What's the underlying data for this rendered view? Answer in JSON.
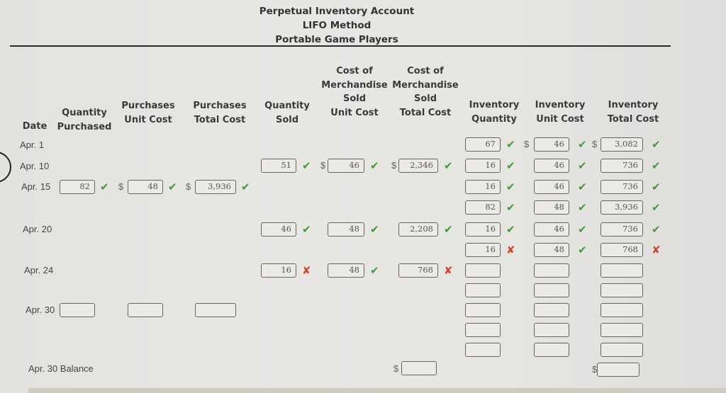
{
  "title": {
    "line1": "Perpetual Inventory Account",
    "line2": "LIFO Method",
    "line3": "Portable Game Players"
  },
  "headers": {
    "date": "Date",
    "qty_purchased": [
      "Quantity",
      "Purchased"
    ],
    "purch_unit_cost": [
      "Purchases",
      "Unit Cost"
    ],
    "purch_total_cost": [
      "Purchases",
      "Total Cost"
    ],
    "qty_sold": [
      "Quantity",
      "Sold"
    ],
    "cogs_unit_cost": [
      "Cost of",
      "Merchandise",
      "Sold",
      "Unit Cost"
    ],
    "cogs_total_cost": [
      "Cost of",
      "Merchandise",
      "Sold",
      "Total Cost"
    ],
    "inv_qty": [
      "Inventory",
      "Quantity"
    ],
    "inv_unit_cost": [
      "Inventory",
      "Unit Cost"
    ],
    "inv_total_cost": [
      "Inventory",
      "Total Cost"
    ]
  },
  "currency_symbol": "$",
  "marks": {
    "correct": "✔",
    "incorrect": "✘"
  },
  "rows": [
    {
      "date": "Apr. 1",
      "inventory": [
        {
          "qty": "67",
          "qty_status": "correct",
          "unit_cost": "46",
          "unit_status": "correct",
          "total": "3,082",
          "total_status": "correct"
        }
      ]
    },
    {
      "date": "Apr. 10",
      "sold": {
        "qty": "51",
        "qty_status": "correct",
        "unit_cost": "46",
        "unit_status": "correct",
        "total": "2,346",
        "total_status": "correct"
      },
      "inventory": [
        {
          "qty": "16",
          "qty_status": "correct",
          "unit_cost": "46",
          "unit_status": "correct",
          "total": "736",
          "total_status": "correct"
        }
      ]
    },
    {
      "date": "Apr. 15",
      "purchase": {
        "qty": "82",
        "qty_status": "correct",
        "unit_cost": "48",
        "unit_status": "correct",
        "total": "3,936",
        "total_status": "correct"
      },
      "inventory": [
        {
          "qty": "16",
          "qty_status": "correct",
          "unit_cost": "46",
          "unit_status": "correct",
          "total": "736",
          "total_status": "correct"
        },
        {
          "qty": "82",
          "qty_status": "correct",
          "unit_cost": "48",
          "unit_status": "correct",
          "total": "3,936",
          "total_status": "correct"
        }
      ]
    },
    {
      "date": "Apr. 20",
      "sold": {
        "qty": "46",
        "qty_status": "correct",
        "unit_cost": "48",
        "unit_status": "correct",
        "total": "2,208",
        "total_status": "correct"
      },
      "inventory": [
        {
          "qty": "16",
          "qty_status": "correct",
          "unit_cost": "46",
          "unit_status": "correct",
          "total": "736",
          "total_status": "correct"
        },
        {
          "qty": "16",
          "qty_status": "incorrect",
          "unit_cost": "48",
          "unit_status": "correct",
          "total": "768",
          "total_status": "incorrect"
        }
      ]
    },
    {
      "date": "Apr. 24",
      "sold": {
        "qty": "16",
        "qty_status": "incorrect",
        "unit_cost": "48",
        "unit_status": "correct",
        "total": "768",
        "total_status": "incorrect"
      },
      "inventory": [
        {
          "qty": "",
          "unit_cost": "",
          "total": ""
        },
        {
          "qty": "",
          "unit_cost": "",
          "total": ""
        }
      ]
    },
    {
      "date": "Apr. 30",
      "purchase": {
        "qty": "",
        "unit_cost": "",
        "total": ""
      },
      "inventory": [
        {
          "qty": "",
          "unit_cost": "",
          "total": ""
        },
        {
          "qty": "",
          "unit_cost": "",
          "total": ""
        },
        {
          "qty": "",
          "unit_cost": "",
          "total": ""
        }
      ]
    }
  ],
  "balance": {
    "label": "Apr. 30  Balance",
    "cogs_total": "",
    "inventory_total": ""
  }
}
